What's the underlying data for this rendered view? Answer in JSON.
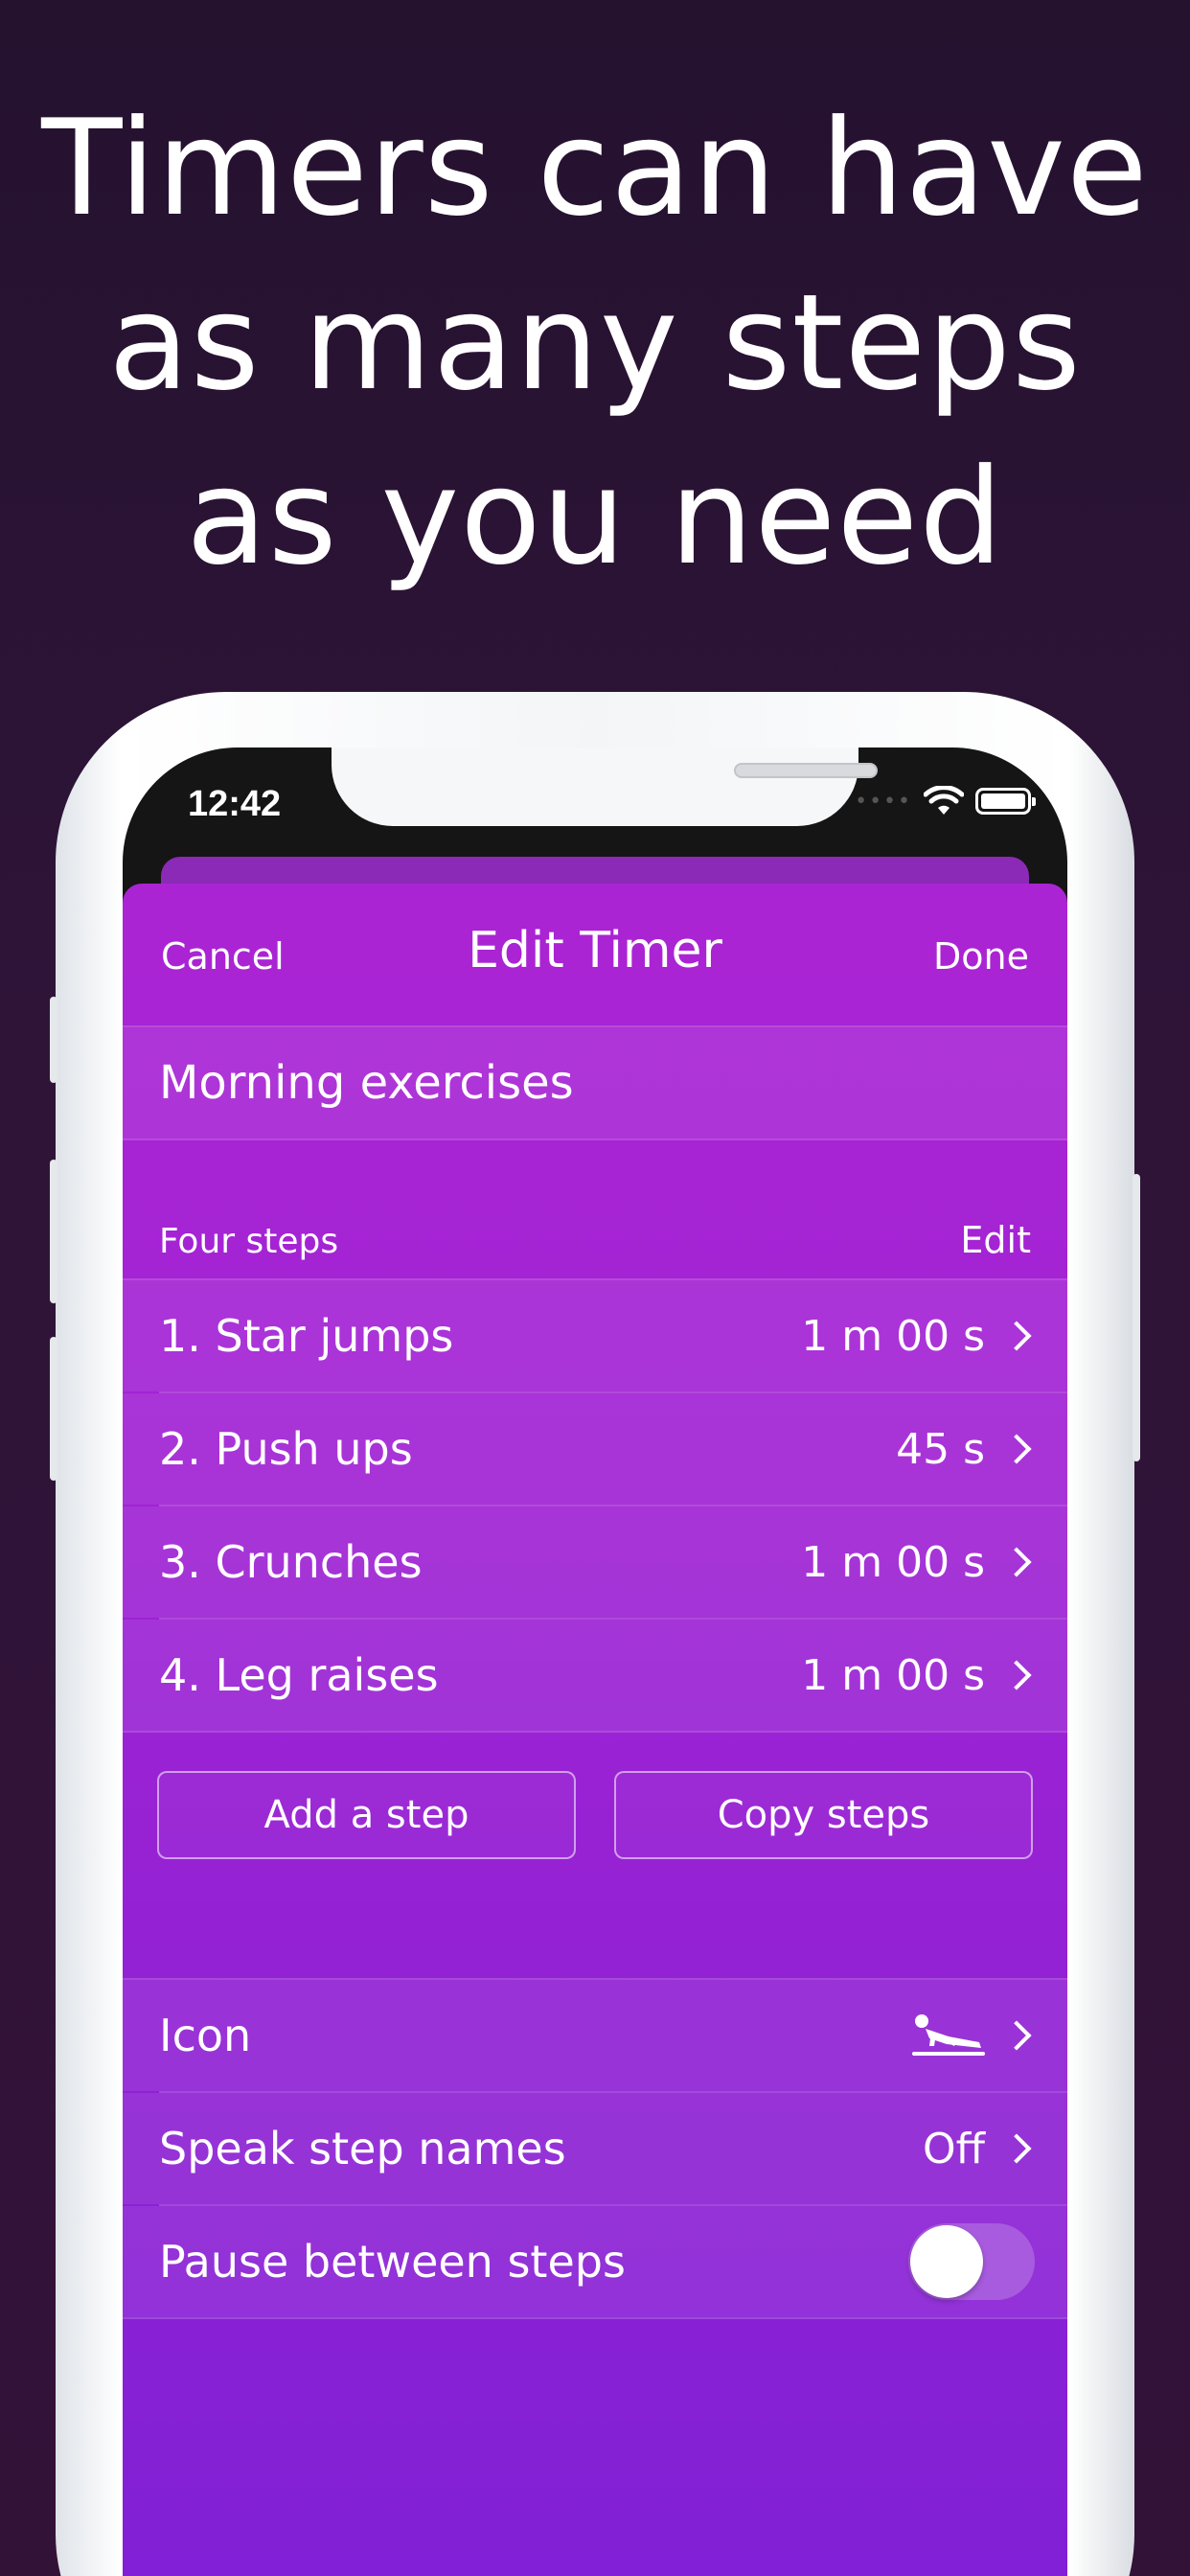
{
  "headline": {
    "line1": "Timers can have",
    "line2": "as many steps",
    "line3": "as you need"
  },
  "status_bar": {
    "time": "12:42",
    "icons": [
      "wifi-icon",
      "battery-icon"
    ]
  },
  "nav": {
    "cancel": "Cancel",
    "title": "Edit Timer",
    "done": "Done"
  },
  "timer": {
    "name": "Morning exercises"
  },
  "steps_section": {
    "title": "Four steps",
    "edit": "Edit",
    "steps": [
      {
        "label": "1. Star jumps",
        "duration": "1 m  00 s"
      },
      {
        "label": "2. Push ups",
        "duration": "45 s"
      },
      {
        "label": "3. Crunches",
        "duration": "1 m  00 s"
      },
      {
        "label": "4. Leg raises",
        "duration": "1 m  00 s"
      }
    ],
    "add_step": "Add a step",
    "copy_steps": "Copy steps"
  },
  "settings": {
    "icon_label": "Icon",
    "icon_name": "push-up-icon",
    "speak_label": "Speak step names",
    "speak_value": "Off",
    "pause_label": "Pause between steps",
    "pause_enabled": false
  },
  "colors": {
    "background": "#2a1433",
    "sheet_top": "#ab24d4",
    "sheet_bottom": "#7e20d6"
  }
}
